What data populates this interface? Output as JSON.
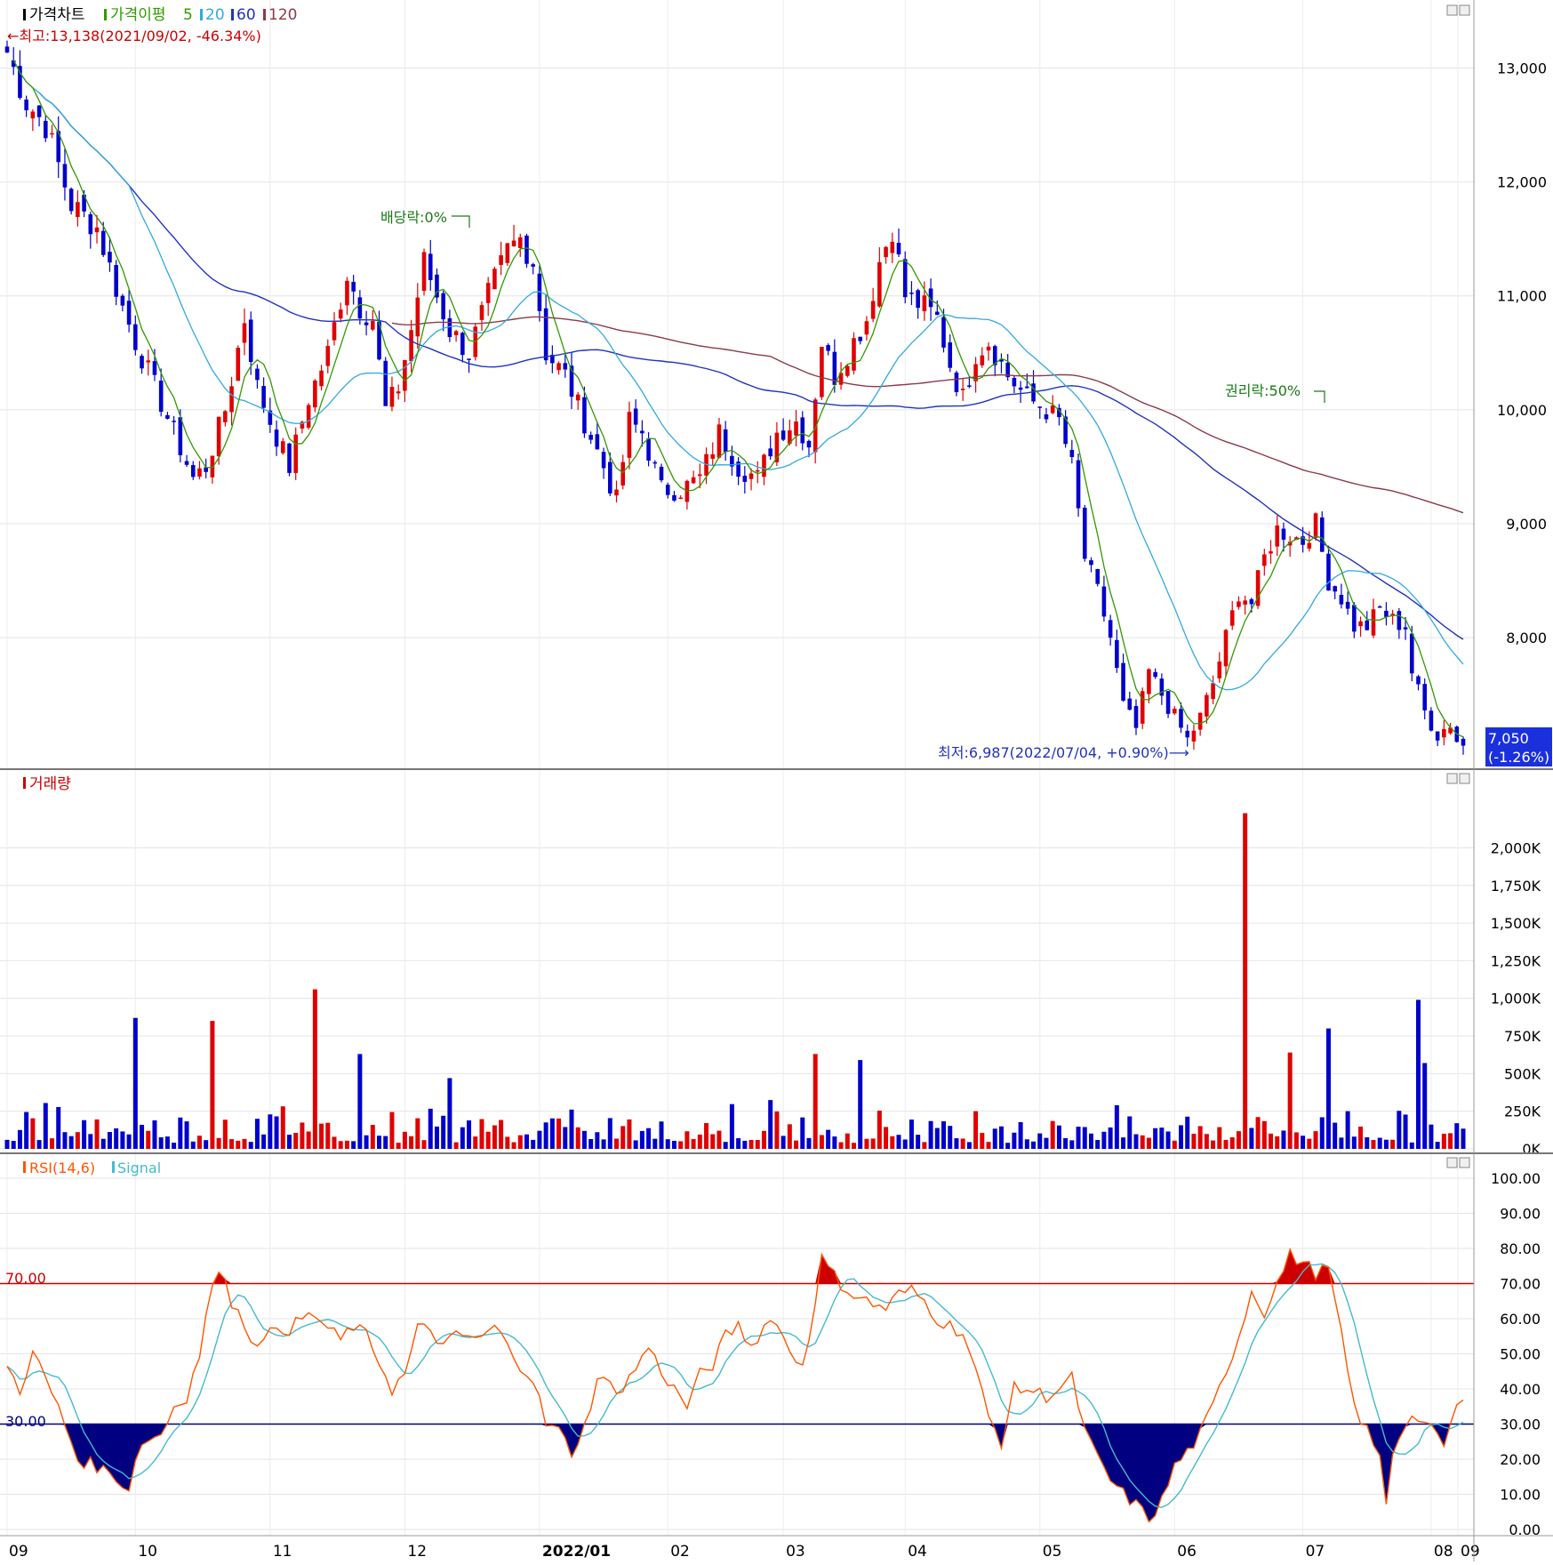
{
  "price_panel": {
    "legend": {
      "price_label": "가격차트",
      "ma_label": "가격이평",
      "ma_periods": [
        "5",
        "20",
        "60",
        "120"
      ]
    },
    "high_annotation": "←최고:13,138(2021/09/02, -46.34%)",
    "low_annotation": "최저:6,987(2022/07/04, +0.90%)⟶",
    "dividend_annotation": "배당락:0%",
    "rights_annotation": "권리락:50%",
    "current_price": "7,050",
    "current_change": "(-1.26%)"
  },
  "volume_panel": {
    "legend": "거래량"
  },
  "rsi_panel": {
    "legend": "RSI(14,6)",
    "signal_label": "Signal",
    "upper_level_label": "70.00",
    "lower_level_label": "30.00"
  },
  "x_axis": {
    "labels": [
      "09",
      "10",
      "11",
      "12",
      "2022/01",
      "02",
      "03",
      "04",
      "05",
      "06",
      "07",
      "08",
      "09"
    ]
  },
  "colors": {
    "up": "#e00000",
    "down": "#0000cc",
    "ma5": "#339900",
    "ma20": "#33aadd",
    "ma60": "#2233bb",
    "ma120": "#8b3a4a",
    "rsi": "#ff5500",
    "signal": "#44bbcc",
    "rsi_upper": "#cc0000",
    "rsi_lower": "#000080"
  },
  "chart_data": [
    {
      "type": "candlestick",
      "name": "price",
      "ylim": [
        6900,
        13300
      ],
      "y_ticks": [
        "13,000",
        "12,000",
        "11,000",
        "10,000",
        "9,000",
        "8,000"
      ],
      "anchors": [
        [
          0,
          13138
        ],
        [
          3,
          12700
        ],
        [
          6,
          12500
        ],
        [
          10,
          11800
        ],
        [
          14,
          11600
        ],
        [
          18,
          10900
        ],
        [
          20,
          10600
        ],
        [
          23,
          10200
        ],
        [
          26,
          9800
        ],
        [
          29,
          9400
        ],
        [
          31,
          9500
        ],
        [
          34,
          10000
        ],
        [
          37,
          10800
        ],
        [
          39,
          10200
        ],
        [
          41,
          9900
        ],
        [
          44,
          9500
        ],
        [
          47,
          10100
        ],
        [
          50,
          10500
        ],
        [
          53,
          11200
        ],
        [
          55,
          10900
        ],
        [
          57,
          10800
        ],
        [
          59,
          10000
        ],
        [
          61,
          10200
        ],
        [
          63,
          10700
        ],
        [
          65,
          11300
        ],
        [
          67,
          11000
        ],
        [
          69,
          10700
        ],
        [
          72,
          10500
        ],
        [
          75,
          11000
        ],
        [
          78,
          11400
        ],
        [
          80,
          11500
        ],
        [
          82,
          11300
        ],
        [
          84,
          10500
        ],
        [
          87,
          10300
        ],
        [
          90,
          9900
        ],
        [
          93,
          9500
        ],
        [
          95,
          9200
        ],
        [
          97,
          9900
        ],
        [
          99,
          9800
        ],
        [
          102,
          9300
        ],
        [
          105,
          9300
        ],
        [
          108,
          9400
        ],
        [
          111,
          9800
        ],
        [
          114,
          9500
        ],
        [
          117,
          9400
        ],
        [
          120,
          9800
        ],
        [
          123,
          9900
        ],
        [
          125,
          9700
        ],
        [
          127,
          10600
        ],
        [
          129,
          10300
        ],
        [
          131,
          10500
        ],
        [
          134,
          10800
        ],
        [
          136,
          11300
        ],
        [
          138,
          11600
        ],
        [
          140,
          11000
        ],
        [
          143,
          10900
        ],
        [
          145,
          10800
        ],
        [
          147,
          10400
        ],
        [
          149,
          10100
        ],
        [
          151,
          10500
        ],
        [
          153,
          10600
        ],
        [
          156,
          10300
        ],
        [
          159,
          10100
        ],
        [
          162,
          10000
        ],
        [
          164,
          9900
        ],
        [
          166,
          9500
        ],
        [
          168,
          8700
        ],
        [
          170,
          8400
        ],
        [
          172,
          8000
        ],
        [
          174,
          7400
        ],
        [
          176,
          7200
        ],
        [
          178,
          7700
        ],
        [
          180,
          7500
        ],
        [
          182,
          7300
        ],
        [
          184,
          7100
        ],
        [
          186,
          7300
        ],
        [
          188,
          7600
        ],
        [
          190,
          8000
        ],
        [
          192,
          8400
        ],
        [
          194,
          8300
        ],
        [
          196,
          8700
        ],
        [
          198,
          8950
        ],
        [
          200,
          8900
        ],
        [
          202,
          8850
        ],
        [
          204,
          9000
        ],
        [
          206,
          8500
        ],
        [
          208,
          8350
        ],
        [
          210,
          8100
        ],
        [
          212,
          8100
        ],
        [
          214,
          8250
        ],
        [
          216,
          8150
        ],
        [
          218,
          8100
        ],
        [
          219,
          7700
        ],
        [
          221,
          7350
        ],
        [
          223,
          7150
        ],
        [
          225,
          7250
        ],
        [
          226,
          7100
        ],
        [
          227,
          7050
        ]
      ],
      "n": 228
    },
    {
      "type": "bar",
      "name": "volume",
      "ylim": [
        0,
        2200000
      ],
      "y_ticks": [
        "2,000K",
        "1,750K",
        "1,500K",
        "1,250K",
        "1,000K",
        "750K",
        "500K",
        "250K",
        "0K"
      ],
      "base_range": [
        40000,
        340000
      ],
      "spikes": [
        [
          20,
          870000
        ],
        [
          32,
          850000
        ],
        [
          48,
          1060000
        ],
        [
          55,
          630000
        ],
        [
          69,
          470000
        ],
        [
          126,
          630000
        ],
        [
          133,
          590000
        ],
        [
          193,
          2230000
        ],
        [
          200,
          640000
        ],
        [
          206,
          800000
        ],
        [
          220,
          990000
        ],
        [
          221,
          570000
        ]
      ]
    },
    {
      "type": "line",
      "name": "rsi",
      "ylim": [
        0,
        100
      ],
      "y_ticks": [
        "100.00",
        "90.00",
        "80.00",
        "70.00",
        "60.00",
        "50.00",
        "40.00",
        "30.00",
        "20.00",
        "10.00",
        "0.00"
      ],
      "levels": [
        70,
        30
      ],
      "anchors": [
        [
          0,
          46
        ],
        [
          2,
          40
        ],
        [
          4,
          50
        ],
        [
          6,
          43
        ],
        [
          9,
          30
        ],
        [
          11,
          20
        ],
        [
          14,
          18
        ],
        [
          17,
          15
        ],
        [
          19,
          11
        ],
        [
          20,
          21
        ],
        [
          22,
          26
        ],
        [
          24,
          27
        ],
        [
          26,
          35
        ],
        [
          28,
          38
        ],
        [
          30,
          50
        ],
        [
          32,
          70
        ],
        [
          34,
          73
        ],
        [
          35,
          65
        ],
        [
          38,
          55
        ],
        [
          40,
          53
        ],
        [
          42,
          58
        ],
        [
          44,
          57
        ],
        [
          46,
          60
        ],
        [
          48,
          61
        ],
        [
          50,
          57
        ],
        [
          52,
          54
        ],
        [
          54,
          58
        ],
        [
          56,
          55
        ],
        [
          58,
          48
        ],
        [
          60,
          40
        ],
        [
          62,
          44
        ],
        [
          64,
          57
        ],
        [
          66,
          57
        ],
        [
          68,
          52
        ],
        [
          70,
          55
        ],
        [
          72,
          55
        ],
        [
          74,
          54
        ],
        [
          76,
          58
        ],
        [
          78,
          52
        ],
        [
          80,
          47
        ],
        [
          82,
          43
        ],
        [
          84,
          30
        ],
        [
          86,
          28
        ],
        [
          88,
          22
        ],
        [
          90,
          29
        ],
        [
          92,
          43
        ],
        [
          94,
          41
        ],
        [
          96,
          40
        ],
        [
          98,
          46
        ],
        [
          100,
          52
        ],
        [
          102,
          45
        ],
        [
          104,
          40
        ],
        [
          106,
          35
        ],
        [
          108,
          44
        ],
        [
          110,
          47
        ],
        [
          112,
          55
        ],
        [
          114,
          58
        ],
        [
          116,
          52
        ],
        [
          118,
          58
        ],
        [
          120,
          60
        ],
        [
          122,
          50
        ],
        [
          124,
          47
        ],
        [
          125,
          55
        ],
        [
          127,
          77
        ],
        [
          129,
          72
        ],
        [
          131,
          68
        ],
        [
          133,
          66
        ],
        [
          135,
          64
        ],
        [
          137,
          63
        ],
        [
          139,
          67
        ],
        [
          141,
          68
        ],
        [
          143,
          65
        ],
        [
          145,
          60
        ],
        [
          147,
          58
        ],
        [
          149,
          56
        ],
        [
          151,
          45
        ],
        [
          153,
          32
        ],
        [
          155,
          25
        ],
        [
          157,
          40
        ],
        [
          159,
          40
        ],
        [
          162,
          38
        ],
        [
          164,
          40
        ],
        [
          166,
          43
        ],
        [
          168,
          28
        ],
        [
          170,
          20
        ],
        [
          172,
          14
        ],
        [
          174,
          10
        ],
        [
          176,
          7
        ],
        [
          178,
          3
        ],
        [
          180,
          8
        ],
        [
          182,
          18
        ],
        [
          184,
          22
        ],
        [
          186,
          27
        ],
        [
          188,
          35
        ],
        [
          190,
          45
        ],
        [
          192,
          55
        ],
        [
          194,
          68
        ],
        [
          196,
          62
        ],
        [
          198,
          70
        ],
        [
          200,
          78
        ],
        [
          202,
          76
        ],
        [
          204,
          73
        ],
        [
          206,
          74
        ],
        [
          208,
          55
        ],
        [
          210,
          35
        ],
        [
          212,
          28
        ],
        [
          214,
          20
        ],
        [
          215,
          8
        ],
        [
          216,
          22
        ],
        [
          218,
          31
        ],
        [
          220,
          32
        ],
        [
          222,
          28
        ],
        [
          224,
          24
        ],
        [
          226,
          35
        ],
        [
          228,
          36
        ]
      ],
      "series": [
        {
          "name": "RSI(14,6)",
          "role": "rsi"
        },
        {
          "name": "Signal",
          "role": "signal"
        }
      ]
    }
  ]
}
